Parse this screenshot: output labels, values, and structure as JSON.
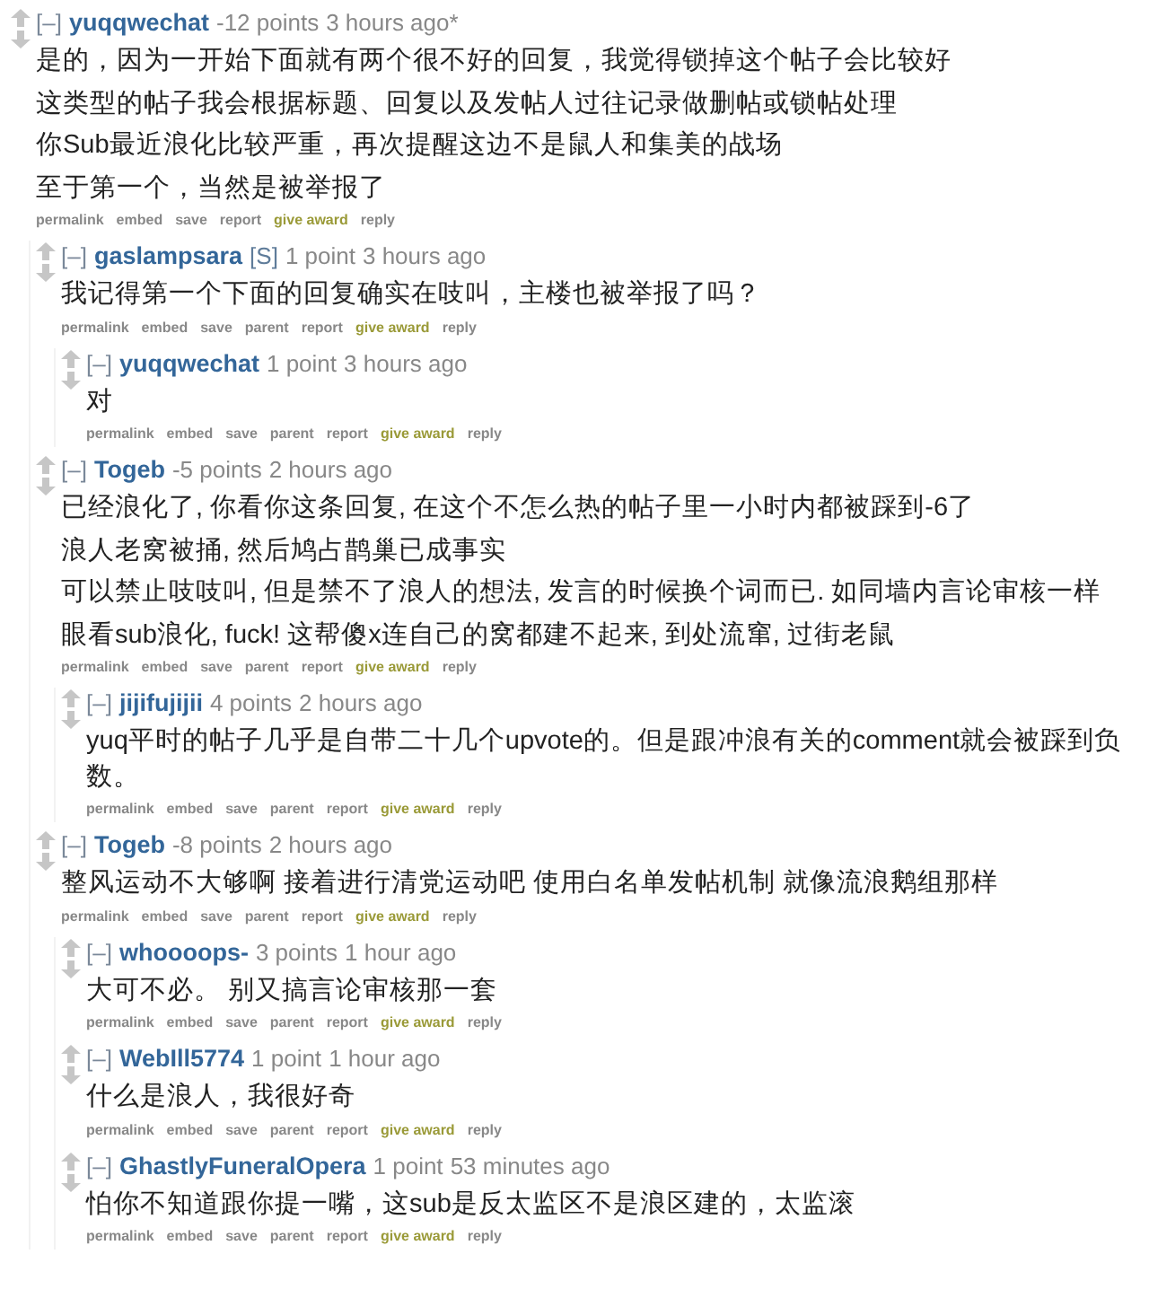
{
  "comments": [
    {
      "author": "yuqqwechat",
      "score": "-12 points",
      "time": "3 hours ago*",
      "lines": [
        "是的，因为一开始下面就有两个很不好的回复，我觉得锁掉这个帖子会比较好",
        "这类型的帖子我会根据标题、回复以及发帖人过往记录做删帖或锁帖处理",
        "你Sub最近浪化比较严重，再次提醒这边不是鼠人和集美的战场",
        "至于第一个，当然是被举报了"
      ],
      "buttons": [
        {
          "label": "permalink",
          "kind": "link"
        },
        {
          "label": "embed",
          "kind": "link"
        },
        {
          "label": "save",
          "kind": "link"
        },
        {
          "label": "report",
          "kind": "link"
        },
        {
          "label": "give award",
          "kind": "award"
        },
        {
          "label": "reply",
          "kind": "link"
        }
      ],
      "children": [
        {
          "author": "gaslampsara",
          "submitter_tag": "[S]",
          "score": "1 point",
          "time": "3 hours ago",
          "lines": [
            "我记得第一个下面的回复确实在吱叫，主楼也被举报了吗？"
          ],
          "buttons": [
            {
              "label": "permalink",
              "kind": "link"
            },
            {
              "label": "embed",
              "kind": "link"
            },
            {
              "label": "save",
              "kind": "link"
            },
            {
              "label": "parent",
              "kind": "link"
            },
            {
              "label": "report",
              "kind": "link"
            },
            {
              "label": "give award",
              "kind": "award"
            },
            {
              "label": "reply",
              "kind": "link"
            }
          ],
          "children": [
            {
              "author": "yuqqwechat",
              "score": "1 point",
              "time": "3 hours ago",
              "lines": [
                "对"
              ],
              "buttons": [
                {
                  "label": "permalink",
                  "kind": "link"
                },
                {
                  "label": "embed",
                  "kind": "link"
                },
                {
                  "label": "save",
                  "kind": "link"
                },
                {
                  "label": "parent",
                  "kind": "link"
                },
                {
                  "label": "report",
                  "kind": "link"
                },
                {
                  "label": "give award",
                  "kind": "award"
                },
                {
                  "label": "reply",
                  "kind": "link"
                }
              ]
            }
          ]
        },
        {
          "author": "Togeb",
          "score": "-5 points",
          "time": "2 hours ago",
          "lines": [
            "已经浪化了, 你看你这条回复, 在这个不怎么热的帖子里一小时内都被踩到-6了",
            "浪人老窝被捅, 然后鸠占鹊巢已成事实",
            "可以禁止吱吱叫, 但是禁不了浪人的想法, 发言的时候换个词而已. 如同墙内言论审核一样",
            "眼看sub浪化, fuck! 这帮傻x连自己的窝都建不起来, 到处流窜, 过街老鼠"
          ],
          "buttons": [
            {
              "label": "permalink",
              "kind": "link"
            },
            {
              "label": "embed",
              "kind": "link"
            },
            {
              "label": "save",
              "kind": "link"
            },
            {
              "label": "parent",
              "kind": "link"
            },
            {
              "label": "report",
              "kind": "link"
            },
            {
              "label": "give award",
              "kind": "award"
            },
            {
              "label": "reply",
              "kind": "link"
            }
          ],
          "children": [
            {
              "author": "jijifujijii",
              "score": "4 points",
              "time": "2 hours ago",
              "lines": [
                "yuq平时的帖子几乎是自带二十几个upvote的。但是跟冲浪有关的comment就会被踩到负数。"
              ],
              "buttons": [
                {
                  "label": "permalink",
                  "kind": "link"
                },
                {
                  "label": "embed",
                  "kind": "link"
                },
                {
                  "label": "save",
                  "kind": "link"
                },
                {
                  "label": "parent",
                  "kind": "link"
                },
                {
                  "label": "report",
                  "kind": "link"
                },
                {
                  "label": "give award",
                  "kind": "award"
                },
                {
                  "label": "reply",
                  "kind": "link"
                }
              ]
            }
          ]
        },
        {
          "author": "Togeb",
          "score": "-8 points",
          "time": "2 hours ago",
          "lines": [
            "整风运动不大够啊 接着进行清党运动吧 使用白名单发帖机制 就像流浪鹅组那样"
          ],
          "buttons": [
            {
              "label": "permalink",
              "kind": "link"
            },
            {
              "label": "embed",
              "kind": "link"
            },
            {
              "label": "save",
              "kind": "link"
            },
            {
              "label": "parent",
              "kind": "link"
            },
            {
              "label": "report",
              "kind": "link"
            },
            {
              "label": "give award",
              "kind": "award"
            },
            {
              "label": "reply",
              "kind": "link"
            }
          ],
          "children": [
            {
              "author": "whoooops-",
              "score": "3 points",
              "time": "1 hour ago",
              "lines": [
                "大可不必。 别又搞言论审核那一套"
              ],
              "buttons": [
                {
                  "label": "permalink",
                  "kind": "link"
                },
                {
                  "label": "embed",
                  "kind": "link"
                },
                {
                  "label": "save",
                  "kind": "link"
                },
                {
                  "label": "parent",
                  "kind": "link"
                },
                {
                  "label": "report",
                  "kind": "link"
                },
                {
                  "label": "give award",
                  "kind": "award"
                },
                {
                  "label": "reply",
                  "kind": "link"
                }
              ]
            },
            {
              "author": "WebIll5774",
              "score": "1 point",
              "time": "1 hour ago",
              "lines": [
                "什么是浪人，我很好奇"
              ],
              "buttons": [
                {
                  "label": "permalink",
                  "kind": "link"
                },
                {
                  "label": "embed",
                  "kind": "link"
                },
                {
                  "label": "save",
                  "kind": "link"
                },
                {
                  "label": "parent",
                  "kind": "link"
                },
                {
                  "label": "report",
                  "kind": "link"
                },
                {
                  "label": "give award",
                  "kind": "award"
                },
                {
                  "label": "reply",
                  "kind": "link"
                }
              ]
            },
            {
              "author": "GhastlyFuneralOpera",
              "score": "1 point",
              "time": "53 minutes ago",
              "lines": [
                "怕你不知道跟你提一嘴，这sub是反太监区不是浪区建的，太监滚"
              ],
              "buttons": [
                {
                  "label": "permalink",
                  "kind": "link"
                },
                {
                  "label": "embed",
                  "kind": "link"
                },
                {
                  "label": "save",
                  "kind": "link"
                },
                {
                  "label": "parent",
                  "kind": "link"
                },
                {
                  "label": "report",
                  "kind": "link"
                },
                {
                  "label": "give award",
                  "kind": "award"
                },
                {
                  "label": "reply",
                  "kind": "link"
                }
              ]
            }
          ]
        }
      ]
    }
  ],
  "collapse_label": "[–]"
}
